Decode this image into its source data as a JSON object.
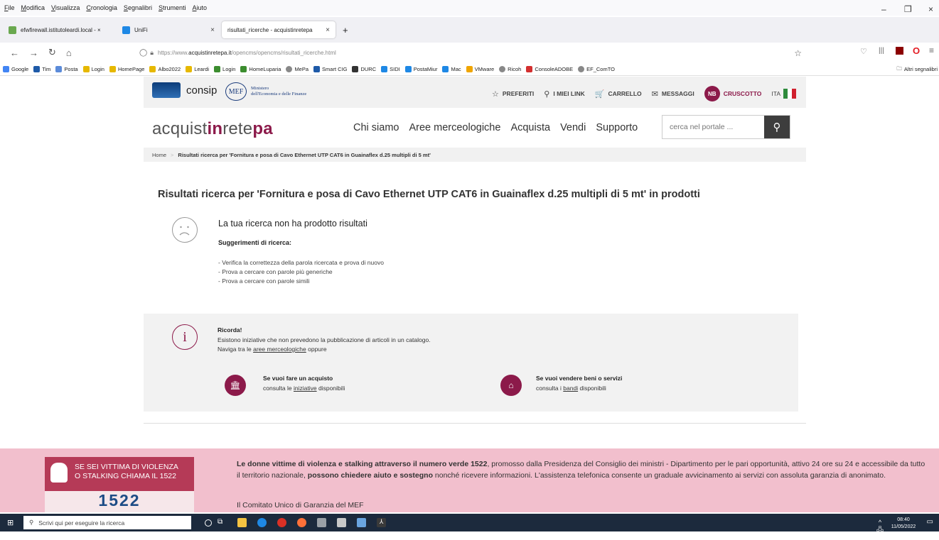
{
  "menu": [
    "File",
    "Modifica",
    "Visualizza",
    "Cronologia",
    "Segnalibri",
    "Strumenti",
    "Aiuto"
  ],
  "tabs": [
    {
      "label": "efwfirewall.istitutoleardi.local - ×",
      "color": "#6aa84f"
    },
    {
      "label": "UniFi",
      "color": "#1e88e5"
    },
    {
      "label": "risultati_ricerche - acquistinretepa",
      "color": "#ffffff"
    }
  ],
  "url": {
    "prefix": "https://www.",
    "host": "acquistinretepa.it",
    "path": "/opencms/opencms/risultati_ricerche.html"
  },
  "bookmarks": [
    {
      "label": "Google",
      "color": "#4285f4"
    },
    {
      "label": "Tim",
      "color": "#1e5aa8"
    },
    {
      "label": "Posta",
      "color": "#5b8bd9"
    },
    {
      "label": "Login",
      "color": "#e6b800"
    },
    {
      "label": "HomePage",
      "color": "#e6b800"
    },
    {
      "label": "Albo2022",
      "color": "#e6b800"
    },
    {
      "label": "Leardi",
      "color": "#e6b800"
    },
    {
      "label": "Login",
      "color": "#3c8d2f"
    },
    {
      "label": "HomeLuparia",
      "color": "#3c8d2f"
    },
    {
      "label": "MePa",
      "color": "#888"
    },
    {
      "label": "Smart CIG",
      "color": "#1e5aa8"
    },
    {
      "label": "DURC",
      "color": "#333"
    },
    {
      "label": "SIDI",
      "color": "#1e88e5"
    },
    {
      "label": "PostaMiur",
      "color": "#1e88e5"
    },
    {
      "label": "Mac",
      "color": "#1e88e5"
    },
    {
      "label": "VMware",
      "color": "#f0a500"
    },
    {
      "label": "Ricoh",
      "color": "#888"
    },
    {
      "label": "ConsoleADOBE",
      "color": "#d32f2f"
    },
    {
      "label": "EF_ComTO",
      "color": "#888"
    }
  ],
  "bookmarks_other": "Altri segnalibri",
  "header": {
    "consip": "consip",
    "mef_ring": "MEF",
    "mef_line1": "Ministero",
    "mef_line2": "dell'Economia e delle Finanze",
    "links": [
      {
        "icon": "☆",
        "label": "PREFERITI"
      },
      {
        "icon": "⚲",
        "label": "I MIEI LINK"
      },
      {
        "icon": "🛒",
        "label": "CARRELLO"
      },
      {
        "icon": "✉",
        "label": "MESSAGGI"
      }
    ],
    "user_initials": "NB",
    "cruscotto": "CRUSCOTTO",
    "lang": "ITA"
  },
  "logo": {
    "a": "acquist",
    "b": "in",
    "c": "rete",
    "d": "pa"
  },
  "nav": [
    "Chi siamo",
    "Aree merceologiche",
    "Acquista",
    "Vendi",
    "Supporto"
  ],
  "search_placeholder": "cerca nel portale ...",
  "breadcrumb": {
    "home": "Home",
    "sep": ">",
    "current": "Risultati ricerca per 'Fornitura e posa di Cavo Ethernet UTP CAT6 in Guainaflex d.25 multipli di 5 mt'"
  },
  "result_title": "Risultati ricerca per 'Fornitura e posa di Cavo Ethernet UTP CAT6 in Guainaflex d.25 multipli di 5 mt' in prodotti",
  "no_results": "La tua ricerca non ha prodotto risultati",
  "suggestions_title": "Suggerimenti di ricerca:",
  "suggestions": [
    "- Verifica la correttezza della parola ricercata e prova di nuovo",
    "- Prova a cercare con parole più generiche",
    "- Prova a cercare con parole simili"
  ],
  "ricorda": {
    "title": "Ricorda!",
    "line1": "Esistono iniziative che non prevedono la pubblicazione di articoli in un catalogo.",
    "line2a": "Naviga tra le ",
    "line2link": "aree merceologiche",
    "line2b": " oppure"
  },
  "cta_buy": {
    "title": "Se vuoi fare un acquisto",
    "pre": "consulta le ",
    "link": "iniziative",
    "post": " disponibili"
  },
  "cta_sell": {
    "title": "Se vuoi vendere beni o servizi",
    "pre": "consulta i ",
    "link": "bandi",
    "post": " disponibili"
  },
  "violence": {
    "line1": "SE SEI VITTIMA DI VIOLENZA",
    "line2": "O STALKING CHIAMA IL 1522",
    "number": "1522"
  },
  "footer": {
    "b1": "Le donne vittime di violenza e stalking attraverso il numero verde 1522",
    "t1": ", promosso dalla Presidenza del Consiglio dei ministri - Dipartimento per le pari opportunità, attivo 24 ore su 24 e accessibile da tutto il territorio nazionale, ",
    "b2": "possono chiedere aiuto e sostegno",
    "t2": " nonché ricevere informazioni. L'assistenza telefonica consente un graduale avvicinamento ai servizi con assoluta garanzia di anonimato.",
    "link": "Il Comitato Unico di Garanzia del MEF"
  },
  "taskbar": {
    "search": "Scrivi qui per eseguire la ricerca",
    "time": "08:40",
    "date": "11/05/2022"
  },
  "colors": {
    "brand": "#8c1a4a",
    "footer_bg": "#f2bfcd"
  }
}
